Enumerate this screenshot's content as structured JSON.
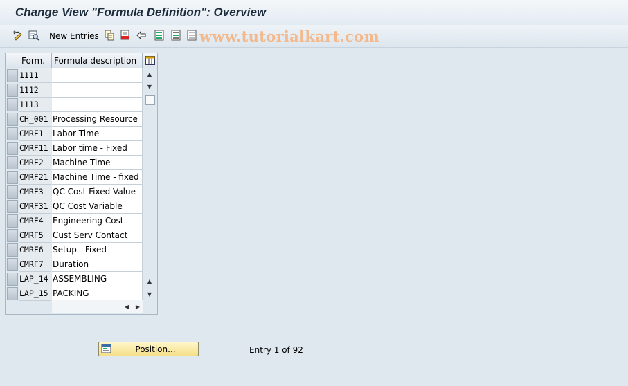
{
  "window": {
    "title": "Change View \"Formula Definition\": Overview"
  },
  "toolbar": {
    "new_entries_label": "New Entries",
    "icons": [
      "change-display-icon",
      "details-icon",
      "copy-icon",
      "delete-icon",
      "undo-icon",
      "select-all-icon",
      "select-block-icon",
      "deselect-all-icon"
    ]
  },
  "watermark": "www.tutorialkart.com",
  "table": {
    "columns": {
      "form": "Form.",
      "description": "Formula description"
    },
    "rows": [
      {
        "form": "1111",
        "description": ""
      },
      {
        "form": "1112",
        "description": ""
      },
      {
        "form": "1113",
        "description": ""
      },
      {
        "form": "CH_001",
        "description": "Processing Resource"
      },
      {
        "form": "CMRF1",
        "description": "Labor Time"
      },
      {
        "form": "CMRF11",
        "description": "Labor time - Fixed"
      },
      {
        "form": "CMRF2",
        "description": "Machine Time"
      },
      {
        "form": "CMRF21",
        "description": "Machine Time - fixed"
      },
      {
        "form": "CMRF3",
        "description": "QC Cost Fixed Value"
      },
      {
        "form": "CMRF31",
        "description": "QC Cost Variable"
      },
      {
        "form": "CMRF4",
        "description": "Engineering Cost"
      },
      {
        "form": "CMRF5",
        "description": "Cust Serv Contact"
      },
      {
        "form": "CMRF6",
        "description": "Setup - Fixed"
      },
      {
        "form": "CMRF7",
        "description": "Duration"
      },
      {
        "form": "LAP_14",
        "description": "ASSEMBLING"
      },
      {
        "form": "LAP_15",
        "description": "PACKING"
      }
    ]
  },
  "footer": {
    "position_label": "Position...",
    "entry_text": "Entry 1 of 92"
  }
}
